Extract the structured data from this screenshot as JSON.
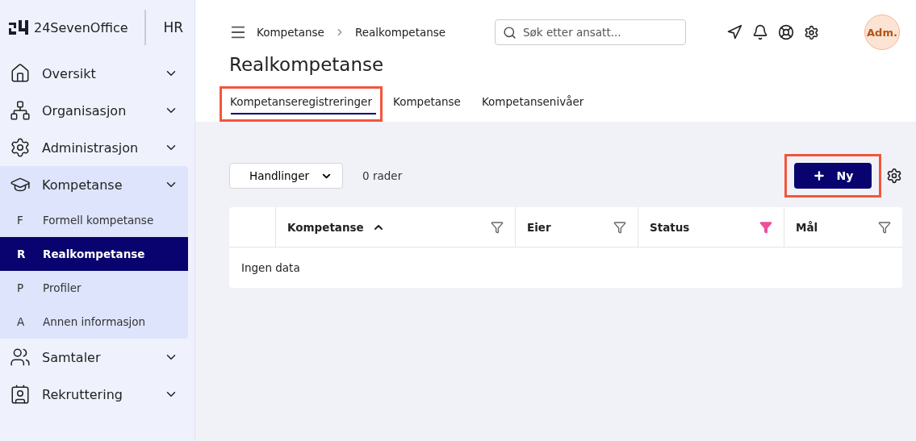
{
  "sidebar": {
    "brand": "24SevenOffice",
    "module": "HR",
    "items": [
      {
        "label": "Oversikt",
        "expanded": false
      },
      {
        "label": "Organisasjon",
        "expanded": false
      },
      {
        "label": "Administrasjon",
        "expanded": false
      },
      {
        "label": "Kompetanse",
        "expanded": true,
        "children": [
          {
            "letter": "F",
            "label": "Formell kompetanse",
            "selected": false
          },
          {
            "letter": "R",
            "label": "Realkompetanse",
            "selected": true
          },
          {
            "letter": "P",
            "label": "Profiler",
            "selected": false
          },
          {
            "letter": "A",
            "label": "Annen informasjon",
            "selected": false
          }
        ]
      },
      {
        "label": "Samtaler",
        "expanded": false
      },
      {
        "label": "Rekruttering",
        "expanded": false
      }
    ]
  },
  "breadcrumb": [
    "Kompetanse",
    "Realkompetanse"
  ],
  "search": {
    "placeholder": "Søk etter ansatt..."
  },
  "avatar": "Adm.",
  "title": "Realkompetanse",
  "tabs": [
    {
      "label": "Kompetanseregistreringer",
      "selected": true,
      "highlighted": true
    },
    {
      "label": "Kompetanse",
      "selected": false,
      "highlighted": false
    },
    {
      "label": "Kompetansenivåer",
      "selected": false,
      "highlighted": false
    }
  ],
  "toolbar": {
    "actions": "Handlinger",
    "count": "0 rader",
    "new_button": {
      "label": "Ny",
      "highlighted": true
    }
  },
  "table": {
    "columns": [
      {
        "label": "Kompetanse",
        "sorted": true,
        "filter_active": false
      },
      {
        "label": "Eier",
        "sorted": false,
        "filter_active": false
      },
      {
        "label": "Status",
        "sorted": false,
        "filter_active": true
      },
      {
        "label": "Mål",
        "sorted": false,
        "filter_active": false
      }
    ],
    "empty": "Ingen data"
  }
}
